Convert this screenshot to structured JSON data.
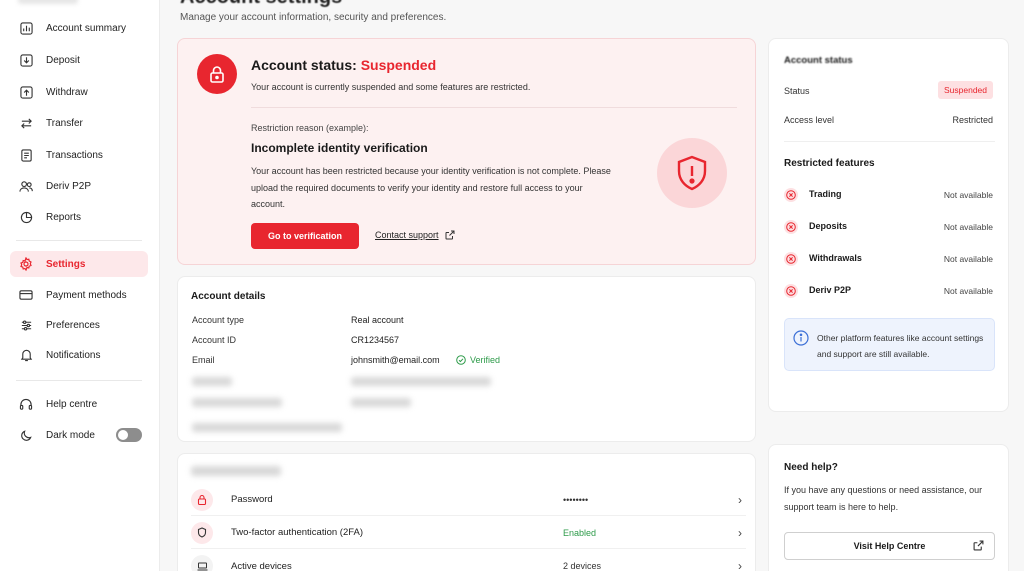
{
  "sidebar": {
    "items": [
      {
        "label": "Account summary",
        "icon": "chart-icon"
      },
      {
        "label": "Deposit",
        "icon": "deposit-icon"
      },
      {
        "label": "Withdraw",
        "icon": "withdraw-icon"
      },
      {
        "label": "Transfer",
        "icon": "transfer-icon"
      },
      {
        "label": "Transactions",
        "icon": "transactions-icon"
      },
      {
        "label": "Deriv P2P",
        "icon": "users-icon"
      },
      {
        "label": "Reports",
        "icon": "pie-icon"
      },
      {
        "label": "Settings",
        "icon": "gear-icon",
        "active": true
      },
      {
        "label": "Payment methods",
        "icon": "card-icon"
      },
      {
        "label": "Preferences",
        "icon": "sliders-icon"
      },
      {
        "label": "Notifications",
        "icon": "bell-icon"
      },
      {
        "label": "Help centre",
        "icon": "headset-icon"
      },
      {
        "label": "Dark mode",
        "icon": "moon-icon",
        "toggle": false
      }
    ]
  },
  "header": {
    "title": "Account settings",
    "subtitle": "Manage your account information, security and preferences."
  },
  "status_card": {
    "title_prefix": "Account status: ",
    "title_status": "Suspended",
    "description": "Your account is currently suspended and some features are restricted.",
    "reason_label": "Restriction reason (example):",
    "reason_title": "Incomplete identity verification",
    "reason_body": "Your account has been restricted because your identity verification is not complete. Please upload the required documents to verify your identity and restore full access to your account.",
    "primary_button": "Go to verification",
    "contact_link": "Contact support"
  },
  "account_details": {
    "title": "Account details",
    "rows": [
      {
        "label": "Account type",
        "value": "Real account"
      },
      {
        "label": "Account ID",
        "value": "CR1234567"
      },
      {
        "label": "Email",
        "value": "johnsmith@email.com"
      }
    ],
    "verified_label": "Verified"
  },
  "security": {
    "rows": [
      {
        "label": "Password",
        "value": "••••••••",
        "icon": "lock-icon"
      },
      {
        "label": "Two-factor authentication (2FA)",
        "value": "Enabled",
        "icon": "shield-icon"
      },
      {
        "label": "Active devices",
        "value": "2 devices",
        "icon": "laptop-icon"
      }
    ]
  },
  "side_status": {
    "title": "Account status",
    "status_label": "Status",
    "status_value": "Suspended",
    "access_label": "Access level",
    "access_value": "Restricted",
    "restricted_title": "Restricted features",
    "features": [
      {
        "label": "Trading",
        "value": "Not available"
      },
      {
        "label": "Deposits",
        "value": "Not available"
      },
      {
        "label": "Withdrawals",
        "value": "Not available"
      },
      {
        "label": "Deriv P2P",
        "value": "Not available"
      }
    ],
    "info": "Other platform features like account settings and support are still available."
  },
  "help": {
    "title": "Need help?",
    "text": "If you have any questions or need assistance, our support team is here to help.",
    "button": "Visit Help Centre"
  },
  "colors": {
    "accent": "#e8262f",
    "success": "#2e9b4a",
    "info": "#3b6fd6"
  }
}
